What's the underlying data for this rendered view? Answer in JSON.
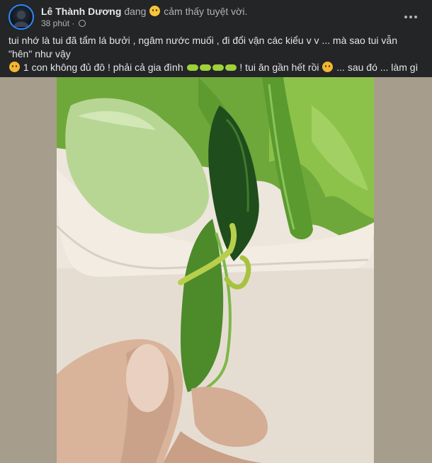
{
  "post": {
    "author": "Lê Thành Dương",
    "feeling_prefix": "đang",
    "feeling_emoji": "slightly-smiling-face",
    "feeling_text": "cảm thấy tuyệt vời.",
    "time": "38 phút",
    "separator": "·",
    "privacy_icon": "globe-icon",
    "more_icon": "more-horizontal-icon",
    "text_part1": "tui nhớ là tui đã tẩm lá bưởi , ngâm nước muối , đi đổi vận các kiểu v v ... mà sao tui vẫn \"hên\" như vậy",
    "text_part2": "1 con không đủ đô ! phải cả gia đình",
    "text_part3": "! tui ăn gần hết rồi",
    "text_part4": "... sau đó ... làm gì có sau đó nữa ...",
    "emojis": [
      "confused-face",
      "caterpillar",
      "caterpillar",
      "caterpillar",
      "caterpillar",
      "crying-face"
    ]
  },
  "photo": {
    "description_icon": "food-photo",
    "colors": {
      "leaf": "#4f8a2a",
      "dark_leaf": "#1f4d1c",
      "melon": "#b8d89a",
      "bowl": "#f3ece2",
      "skin": "#d8b49b"
    }
  }
}
